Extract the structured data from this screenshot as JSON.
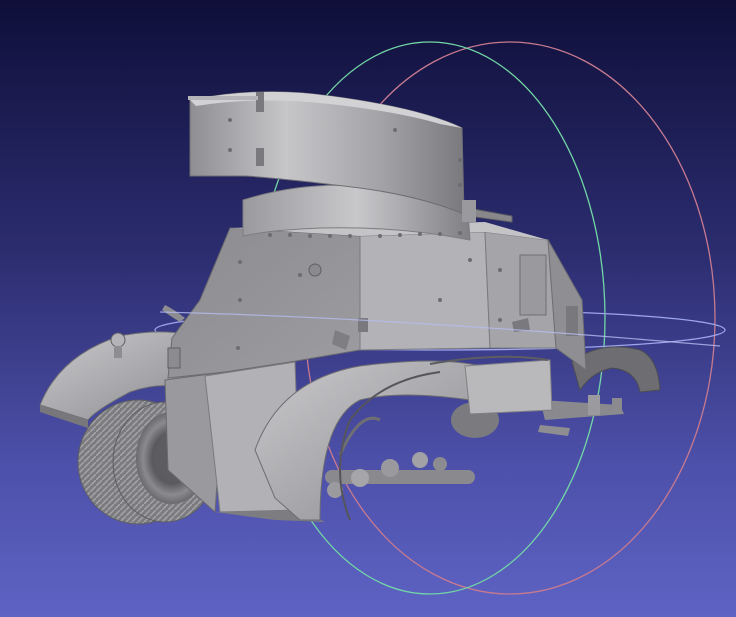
{
  "viewer": {
    "background_top": "#0f0f3a",
    "background_bottom": "#5e63c4",
    "model_color": "#a9a9ad"
  },
  "trackball": {
    "x_ring_color": "#c77a8f",
    "y_ring_color": "#72d7a6",
    "z_ring_color": "#9ea5ea"
  },
  "model": {
    "name": "armored-car"
  }
}
